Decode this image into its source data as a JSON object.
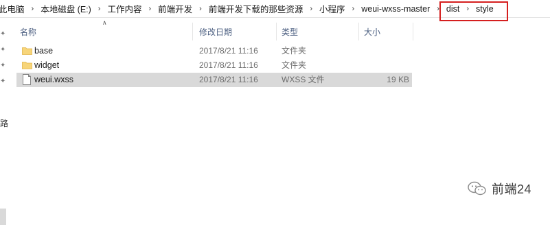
{
  "breadcrumb": [
    {
      "label": "此电脑"
    },
    {
      "label": "本地磁盘 (E:)"
    },
    {
      "label": "工作内容"
    },
    {
      "label": "前端开发"
    },
    {
      "label": "前端开发下载的那些资源"
    },
    {
      "label": "小程序"
    },
    {
      "label": "weui-wxss-master"
    },
    {
      "label": "dist"
    },
    {
      "label": "style"
    }
  ],
  "left_nav": {
    "partial_char": "路"
  },
  "columns": {
    "name": "名称",
    "modified": "修改日期",
    "type": "类型",
    "size": "大小"
  },
  "files": [
    {
      "name": "base",
      "modified": "2017/8/21 11:16",
      "type": "文件夹",
      "size": "",
      "icon": "folder-icon",
      "selected": false
    },
    {
      "name": "widget",
      "modified": "2017/8/21 11:16",
      "type": "文件夹",
      "size": "",
      "icon": "folder-icon",
      "selected": false
    },
    {
      "name": "weui.wxss",
      "modified": "2017/8/21 11:16",
      "type": "WXSS 文件",
      "size": "19 KB",
      "icon": "file-icon",
      "selected": true
    }
  ],
  "watermark": {
    "text": "前端24"
  },
  "colors": {
    "highlight_border": "#d51f1f",
    "selected_row": "#d9d9d9",
    "folder": "#f7d57a",
    "header_text": "#4d6082"
  }
}
